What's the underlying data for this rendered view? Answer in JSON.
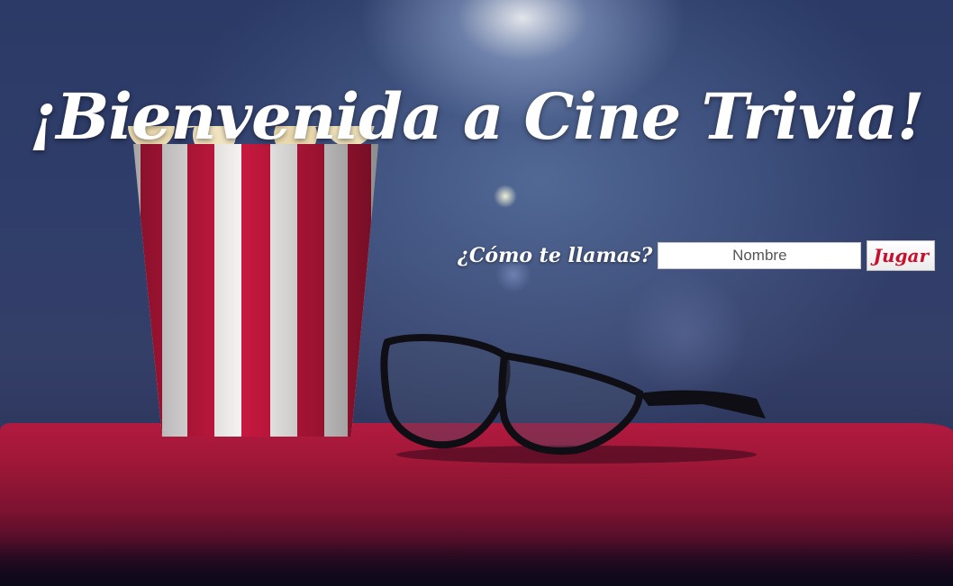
{
  "page": {
    "title": "¡Bienvenida a Cine Trivia!"
  },
  "form": {
    "label": "¿Cómo te llamas?",
    "name_placeholder": "Nombre",
    "name_value": "",
    "play_label": "Jugar"
  },
  "colors": {
    "button_text": "#c8102e",
    "seat": "#9e1737",
    "background": "#2f3d6a",
    "popcorn_stripe": "#c8183f"
  }
}
